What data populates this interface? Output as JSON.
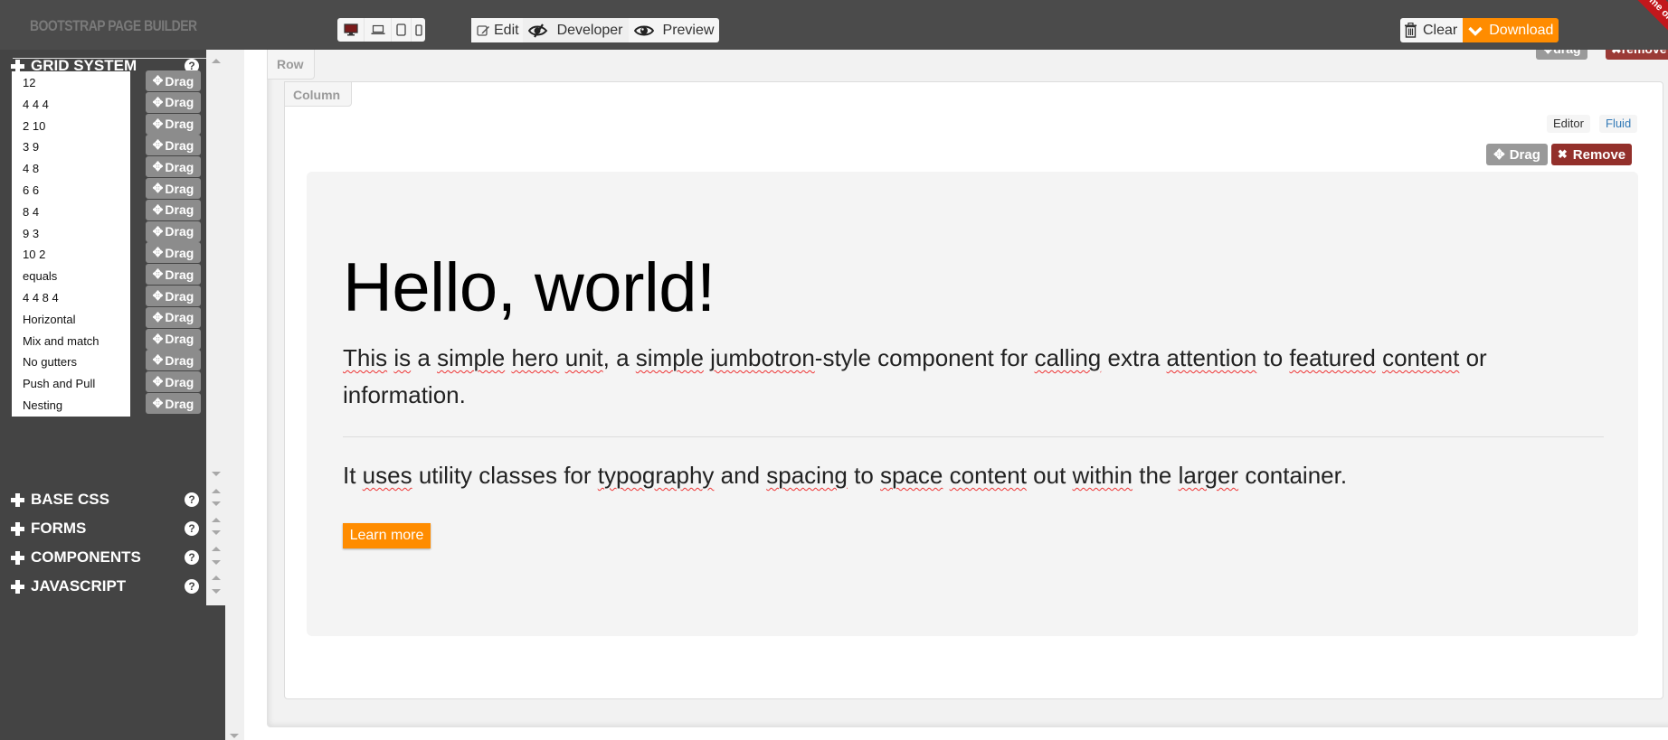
{
  "app": {
    "brand": "BOOTSTRAP PAGE BUILDER",
    "ribbon": "Fork me on GitHub"
  },
  "toolbar": {
    "devices": [
      {
        "name": "desktop",
        "icon": "monitor-icon"
      },
      {
        "name": "laptop",
        "icon": "laptop-icon"
      },
      {
        "name": "tablet",
        "icon": "tablet-icon"
      },
      {
        "name": "phone",
        "icon": "phone-icon"
      }
    ],
    "modes": {
      "edit": "Edit",
      "developer": "Developer",
      "preview": "Preview"
    },
    "clear": "Clear",
    "download": "Download"
  },
  "sidebar": {
    "help_glyph": "?",
    "drag_label": "Drag",
    "sections": [
      {
        "title": "GRID SYSTEM",
        "expanded": true
      },
      {
        "title": "BASE CSS",
        "expanded": false
      },
      {
        "title": "FORMS",
        "expanded": false
      },
      {
        "title": "COMPONENTS",
        "expanded": false
      },
      {
        "title": "JAVASCRIPT",
        "expanded": false
      }
    ],
    "grid_items": [
      "12",
      "4 4 4",
      "2 10",
      "3 9",
      "4 8",
      "6 6",
      "8 4",
      "9 3",
      "10 2",
      "equals",
      "4 4 8 4",
      "Horizontal",
      "Mix and match",
      "No gutters",
      "Push and Pull",
      "Nesting"
    ]
  },
  "canvas": {
    "row": {
      "label": "Row",
      "drag": "drag",
      "remove": "remove"
    },
    "column": {
      "label": "Column",
      "editor": "Editor",
      "fluid": "Fluid",
      "drag": "Drag",
      "remove": "Remove"
    },
    "jumbotron": {
      "title": "Hello, world!",
      "lead_words": [
        {
          "t": "This",
          "sp": true
        },
        {
          "t": " "
        },
        {
          "t": "is",
          "sp": true
        },
        {
          "t": " a "
        },
        {
          "t": "simple",
          "sp": true
        },
        {
          "t": " "
        },
        {
          "t": "hero",
          "sp": true
        },
        {
          "t": " "
        },
        {
          "t": "unit",
          "sp": true
        },
        {
          "t": ", a "
        },
        {
          "t": "simple",
          "sp": true
        },
        {
          "t": " "
        },
        {
          "t": "jumbotron",
          "sp": true
        },
        {
          "t": "-style component for "
        },
        {
          "t": "calling",
          "sp": true
        },
        {
          "t": " extra "
        },
        {
          "t": "attention",
          "sp": true
        },
        {
          "t": " to "
        },
        {
          "t": "featured",
          "sp": true
        },
        {
          "t": " "
        },
        {
          "t": "content",
          "sp": true
        },
        {
          "t": " or information."
        }
      ],
      "body_words": [
        {
          "t": "It "
        },
        {
          "t": "uses",
          "sp": true
        },
        {
          "t": " utility classes for "
        },
        {
          "t": "typography",
          "sp": true
        },
        {
          "t": " and "
        },
        {
          "t": "spacing",
          "sp": true
        },
        {
          "t": " to "
        },
        {
          "t": "space",
          "sp": true
        },
        {
          "t": " "
        },
        {
          "t": "content",
          "sp": true
        },
        {
          "t": " out "
        },
        {
          "t": "within",
          "sp": true
        },
        {
          "t": " the "
        },
        {
          "t": "larger",
          "sp": true
        },
        {
          "t": " container."
        }
      ],
      "button": "Learn more"
    }
  },
  "colors": {
    "navbar": "#4b4b4b",
    "sidebar": "#444444",
    "accent_orange": "#ff8c00",
    "remove_red": "#93302b",
    "drag_gray": "#8c8c8c",
    "fluid_link": "#337ab7"
  }
}
